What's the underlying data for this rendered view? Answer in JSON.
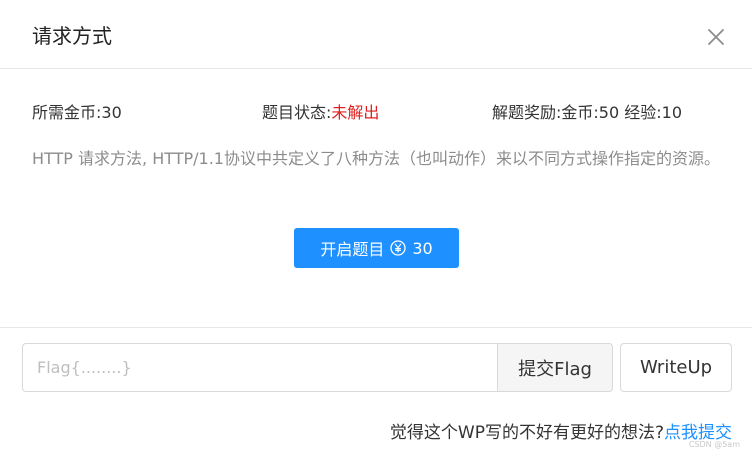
{
  "dialog": {
    "title": "请求方式",
    "close_icon": "close-icon"
  },
  "info": {
    "coins_label": "所需金币:",
    "coins_value": "30",
    "status_label": "题目状态:",
    "status_value": "未解出",
    "reward_label": "解题奖励:",
    "reward_value": "金币:50 经验:10"
  },
  "description": "HTTP 请求方法, HTTP/1.1协议中共定义了八种方法（也叫动作）来以不同方式操作指定的资源。",
  "start_button": {
    "label": "开启题目",
    "coin_icon": "yen-coin-icon",
    "cost": "30"
  },
  "flag_input": {
    "placeholder": "Flag{........}",
    "value": ""
  },
  "submit_button": {
    "label": "提交Flag"
  },
  "writeup_button": {
    "label": "WriteUp"
  },
  "feedback": {
    "text": "觉得这个WP写的不好有更好的想法?",
    "link": "点我提交"
  },
  "watermark": "CSDN @5am",
  "colors": {
    "primary": "#1e90ff",
    "status_unsolved": "#e02020",
    "description_text": "#8c8c8c"
  }
}
